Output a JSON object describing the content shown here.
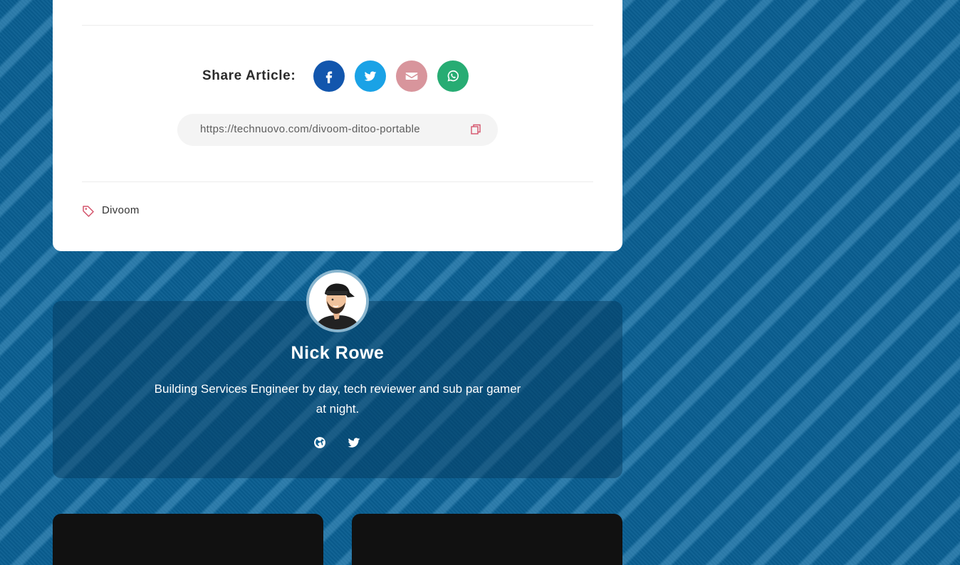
{
  "share": {
    "label": "Share Article:",
    "buttons": [
      {
        "network": "facebook",
        "icon": "facebook-icon",
        "color": "#1256ad"
      },
      {
        "network": "twitter",
        "icon": "twitter-icon",
        "color": "#1aa2e6"
      },
      {
        "network": "email",
        "icon": "envelope-icon",
        "color": "#d8959c"
      },
      {
        "network": "whatsapp",
        "icon": "whatsapp-icon",
        "color": "#27ac73"
      }
    ],
    "url": "https://technuovo.com/divoom-ditoo-portable"
  },
  "tags": {
    "icon": "tag-icon",
    "items": [
      "Divoom"
    ]
  },
  "author": {
    "name": "Nick Rowe",
    "bio": "Building Services Engineer by day, tech reviewer and sub par gamer at night.",
    "social": [
      {
        "icon": "globe-icon"
      },
      {
        "icon": "twitter-icon"
      }
    ]
  },
  "colors": {
    "background": "#0a5f92",
    "accent_tag": "#d4536b"
  }
}
